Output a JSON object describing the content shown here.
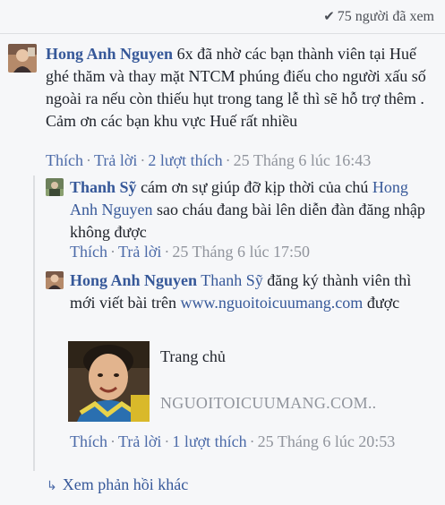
{
  "seen": {
    "icon": "checkmark-icon",
    "text": "75 người đã xem"
  },
  "comments": [
    {
      "author": "Hong Anh Nguyen",
      "text": "6x đã nhờ các bạn thành viên tại Huế ghé thăm và thay mặt NTCM phúng điếu cho người xấu số ngoài ra nếu còn thiếu hụt trong tang lễ thì sẽ hỗ trợ thêm . Cảm ơn các bạn khu vực Huế rất nhiều",
      "like": "Thích",
      "reply": "Trả lời",
      "likes_count": "2 lượt thích",
      "time": "25 Tháng 6 lúc 16:43"
    },
    {
      "author": "Thanh Sỹ",
      "text_before": "cám ơn sự giúp đỡ kịp thời của chú",
      "mention": "Hong Anh Nguyen",
      "text_after": "sao cháu đang bài lên diễn đàn đăng nhập không được",
      "like": "Thích",
      "reply": "Trả lời",
      "time": "25 Tháng 6 lúc 17:50"
    },
    {
      "author": "Hong Anh Nguyen",
      "mention": "Thanh Sỹ",
      "text_before": "đăng ký thành viên thì mới viết bài trên",
      "link": "www.nguoitoicuumang.com",
      "text_after": "được",
      "preview_title": "Trang chủ",
      "preview_domain": "NGUOITOICUUMANG.COM",
      "like": "Thích",
      "reply": "Trả lời",
      "likes_count": "1 lượt thích",
      "time": "25 Tháng 6 lúc 20:53"
    }
  ],
  "more_replies": "Xem phản hồi khác"
}
